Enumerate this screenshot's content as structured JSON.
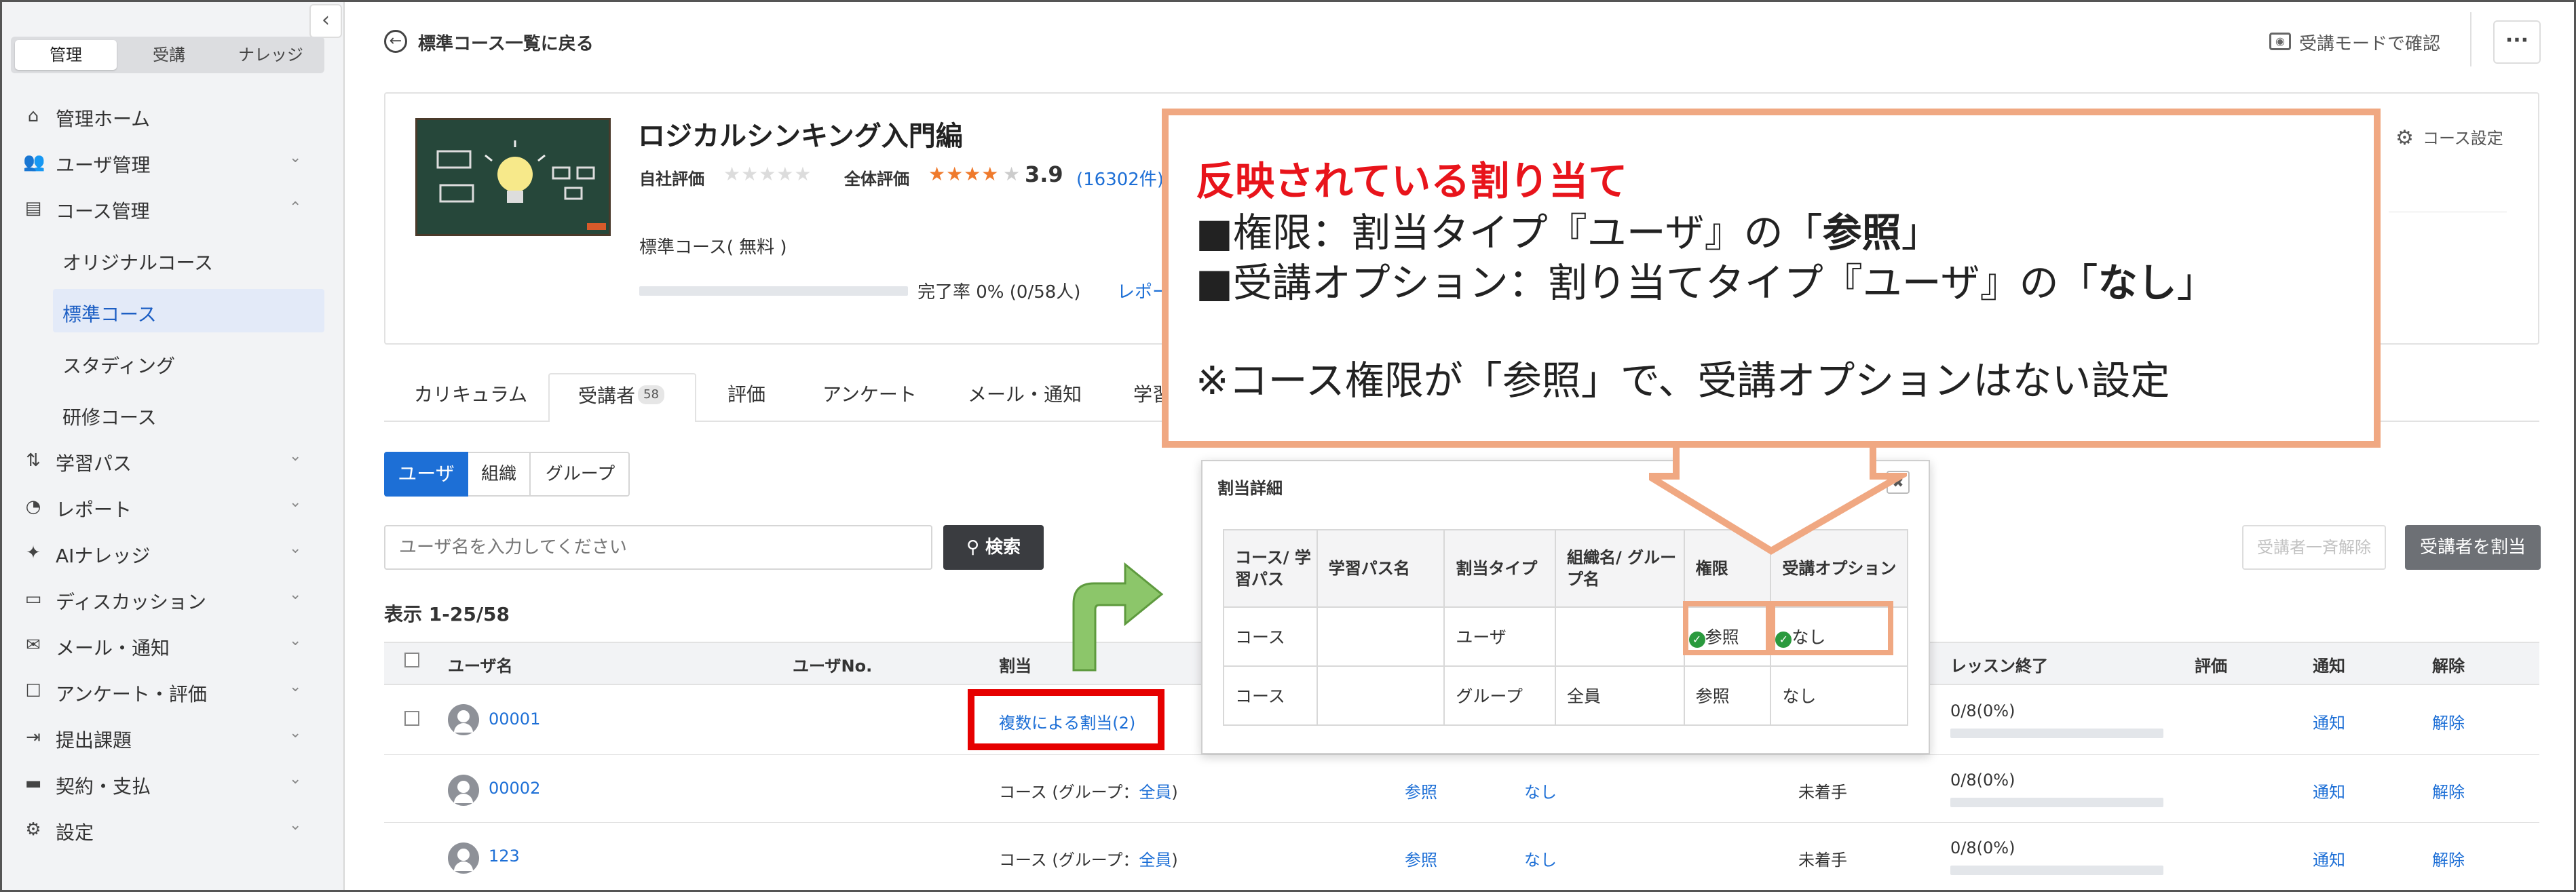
{
  "sidebar": {
    "mode_tabs": [
      "管理",
      "受講",
      "ナレッジ"
    ],
    "nav": [
      {
        "label": "管理ホーム",
        "icon": "home-icon",
        "expandable": false
      },
      {
        "label": "ユーザ管理",
        "icon": "users-icon",
        "expandable": true
      },
      {
        "label": "コース管理",
        "icon": "clipboard-icon",
        "expandable": true,
        "expanded": true
      },
      {
        "label": "学習パス",
        "icon": "path-icon",
        "expandable": true
      },
      {
        "label": "レポート",
        "icon": "pie-chart-icon",
        "expandable": true
      },
      {
        "label": "AIナレッジ",
        "icon": "sparkle-icon",
        "expandable": true
      },
      {
        "label": "ディスカッション",
        "icon": "chat-icon",
        "expandable": true
      },
      {
        "label": "メール・通知",
        "icon": "mail-icon",
        "expandable": true
      },
      {
        "label": "アンケート・評価",
        "icon": "survey-icon",
        "expandable": true
      },
      {
        "label": "提出課題",
        "icon": "submit-icon",
        "expandable": true
      },
      {
        "label": "契約・支払",
        "icon": "card-icon",
        "expandable": true
      },
      {
        "label": "設定",
        "icon": "gear-icon",
        "expandable": true
      }
    ],
    "course_sub": [
      "オリジナルコース",
      "標準コース",
      "スタディング",
      "研修コース"
    ]
  },
  "header": {
    "back_label": "標準コース一覧に戻る",
    "preview_label": "受講モードで確認",
    "more_label": "···"
  },
  "course": {
    "title": "ロジカルシンキング入門編",
    "self_rating_label": "自社評価",
    "overall_rating_label": "全体評価",
    "overall_stars": "★★★★",
    "overall_score": "3.9",
    "review_count": "(16302件)",
    "type": "標準コース( 無料 )",
    "completion": "完了率 0% (0/58人)",
    "report_link": "レポー",
    "settings_label": "コース設定"
  },
  "tabs": [
    "カリキュラム",
    "受講者",
    "評価",
    "アンケート",
    "メール・通知",
    "学習"
  ],
  "tab_badge": "58",
  "subtabs": [
    "ユーザ",
    "組織",
    "グループ"
  ],
  "search": {
    "placeholder": "ユーザ名を入力してください",
    "button": "検索"
  },
  "actions": {
    "bulk_release": "受講者一斉解除",
    "assign": "受講者を割当"
  },
  "count_label": "表示 1-25/58",
  "table": {
    "headers": [
      "ユーザ名",
      "ユーザNo.",
      "割当",
      "レッスン終了",
      "評価",
      "通知",
      "解除"
    ],
    "rows": [
      {
        "name": "00001",
        "assign": "複数による割当(2)",
        "perm": "",
        "opt": "",
        "status": "",
        "lesson": "0/8(0%)",
        "notify": "通知",
        "release": "解除",
        "progress": 0
      },
      {
        "name": "00002",
        "assign_prefix": "コース (グループ：",
        "assign_link": "全員",
        "assign_suffix": ")",
        "perm": "参照",
        "opt": "なし",
        "status": "未着手",
        "lesson": "0/8(0%)",
        "notify": "通知",
        "release": "解除",
        "progress": 0
      },
      {
        "name": "123",
        "assign_prefix": "コース (グループ：",
        "assign_link": "全員",
        "assign_suffix": ")",
        "perm": "参照",
        "opt": "なし",
        "status": "未着手",
        "lesson": "0/8(0%)",
        "notify": "通知",
        "release": "解除",
        "progress": 0
      }
    ]
  },
  "popup": {
    "title": "割当詳細",
    "close": "✖",
    "headers": [
      "コース/ 学習パス",
      "学習パス名",
      "割当タイプ",
      "組織名/ グループ名",
      "権限",
      "受講オプション"
    ],
    "rows": [
      [
        "コース",
        "",
        "ユーザ",
        "",
        "参照",
        "なし"
      ],
      [
        "コース",
        "",
        "グループ",
        "全員",
        "参照",
        "なし"
      ]
    ]
  },
  "callout": {
    "heading": "反映されている割り当て",
    "line1_prefix": "■権限：割当タイプ『ユーザ』の「",
    "line1_bold": "参照",
    "line1_suffix": "」",
    "line2_prefix": "■受講オプション：割り当てタイプ『ユーザ』の「",
    "line2_bold": "なし",
    "line2_suffix": "」",
    "note": "※コース権限が「参照」で、受講オプションはない設定"
  },
  "colors": {
    "accent": "#1d6fd6",
    "callout_border": "#f0a882",
    "highlight_red": "#e00000",
    "arrow_green": "#8cc66a",
    "heading_red": "#e8141b"
  }
}
